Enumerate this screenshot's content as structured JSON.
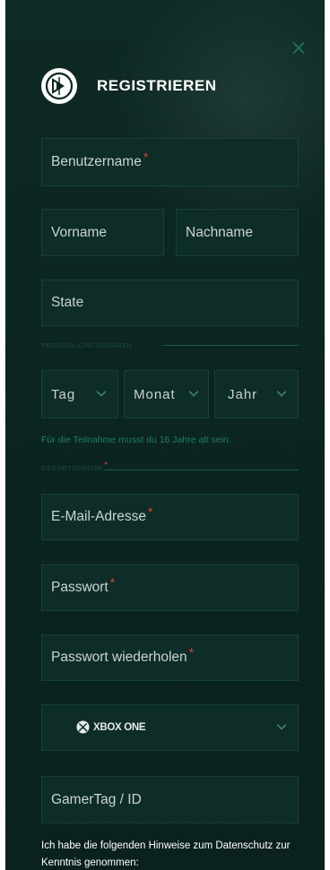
{
  "dialog": {
    "title": "REGISTRIEREN",
    "close_icon": "close-icon",
    "logo_icon": "dfb-logo-icon"
  },
  "fields": {
    "username_placeholder": "Benutzername",
    "firstname_placeholder": "Vorname",
    "lastname_placeholder": "Nachname",
    "state_placeholder": "State",
    "email_placeholder": "E-Mail-Adresse",
    "password_placeholder": "Passwort",
    "password_repeat_placeholder": "Passwort wiederholen",
    "gamertag_placeholder": "GamerTag / ID",
    "required_marker": "*"
  },
  "sections": {
    "personal_label": "PERSÖNLICHE ANGABEN",
    "birthdate_label": "GEBURTSDATUM"
  },
  "birthdate": {
    "day_label": "Tag",
    "month_label": "Monat",
    "year_label": "Jahr"
  },
  "age_notice": "Für die Teilnahme musst du 16 Jahre alt sein.",
  "platform": {
    "selected": "XBOX ONE",
    "icon": "xbox-icon"
  },
  "consent_text": "Ich habe die folgenden Hinweise zum Datenschutz zur Kenntnis genommen:",
  "colors": {
    "panel_bg": "#0c2622",
    "field_bg": "#0f2d28",
    "accent_green": "#1f7d63",
    "required_red": "#e03c31"
  }
}
